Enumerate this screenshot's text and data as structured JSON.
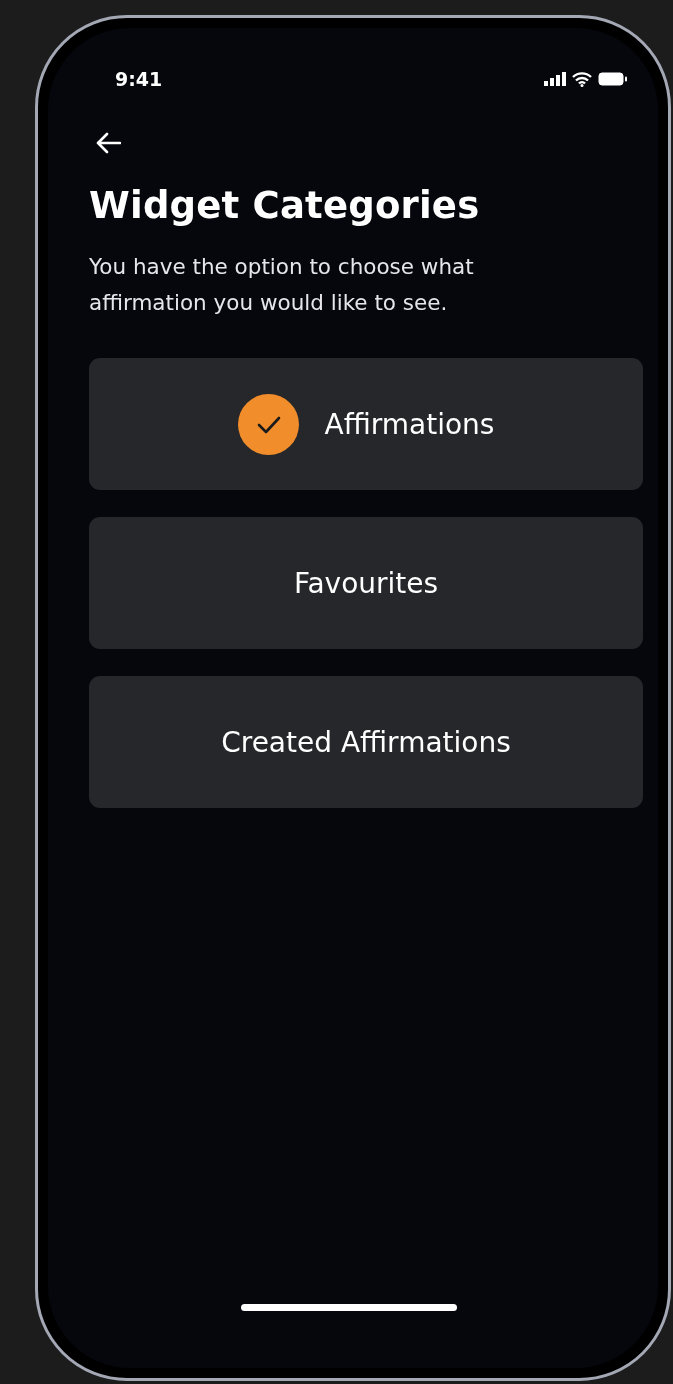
{
  "status_bar": {
    "time": "9:41"
  },
  "header": {
    "title": "Widget Categories",
    "subtitle": "You have the option to choose what affirmation you would like to see."
  },
  "categories": [
    {
      "label": "Affirmations",
      "selected": true
    },
    {
      "label": "Favourites",
      "selected": false
    },
    {
      "label": "Created Affirmations",
      "selected": false
    }
  ]
}
